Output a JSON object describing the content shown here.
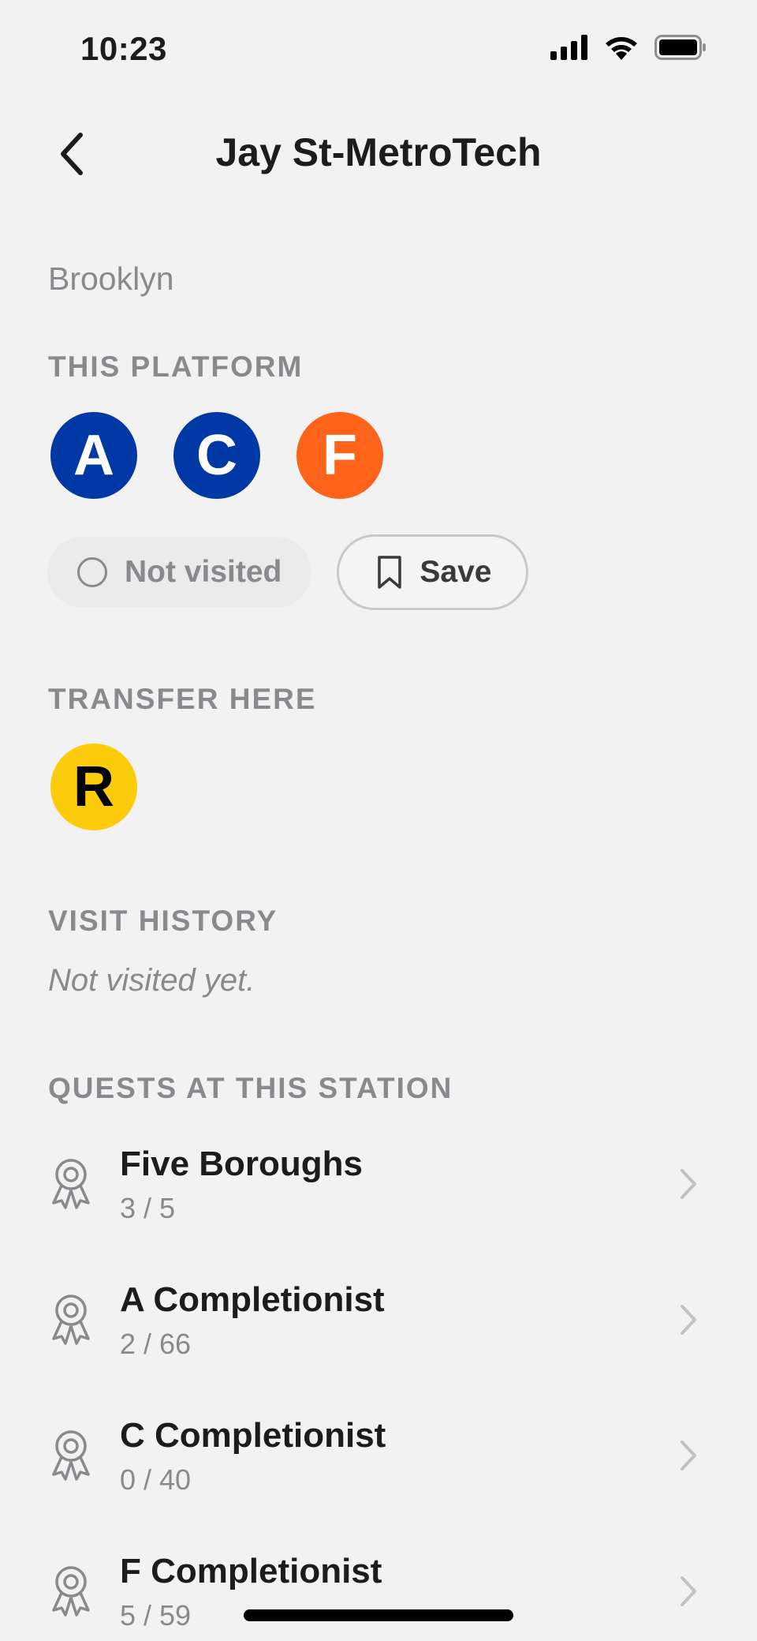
{
  "status_bar": {
    "time": "10:23"
  },
  "nav": {
    "title": "Jay St-MetroTech"
  },
  "station": {
    "borough": "Brooklyn"
  },
  "platform": {
    "label": "THIS PLATFORM",
    "routes": [
      {
        "letter": "A",
        "color": "#0039a6",
        "text_color": "#ffffff"
      },
      {
        "letter": "C",
        "color": "#0039a6",
        "text_color": "#ffffff"
      },
      {
        "letter": "F",
        "color": "#ff6319",
        "text_color": "#ffffff"
      }
    ]
  },
  "actions": {
    "visited_label": "Not visited",
    "save_label": "Save"
  },
  "transfer": {
    "label": "TRANSFER HERE",
    "routes": [
      {
        "letter": "R",
        "color": "#fccc0a",
        "text_color": "#000000"
      }
    ]
  },
  "visit_history": {
    "label": "VISIT HISTORY",
    "empty_text": "Not visited yet."
  },
  "quests": {
    "label": "QUESTS AT THIS STATION",
    "items": [
      {
        "name": "Five Boroughs",
        "progress": "3 / 5"
      },
      {
        "name": "A Completionist",
        "progress": "2 / 66"
      },
      {
        "name": "C Completionist",
        "progress": "0 / 40"
      },
      {
        "name": "F Completionist",
        "progress": "5 / 59"
      }
    ]
  }
}
